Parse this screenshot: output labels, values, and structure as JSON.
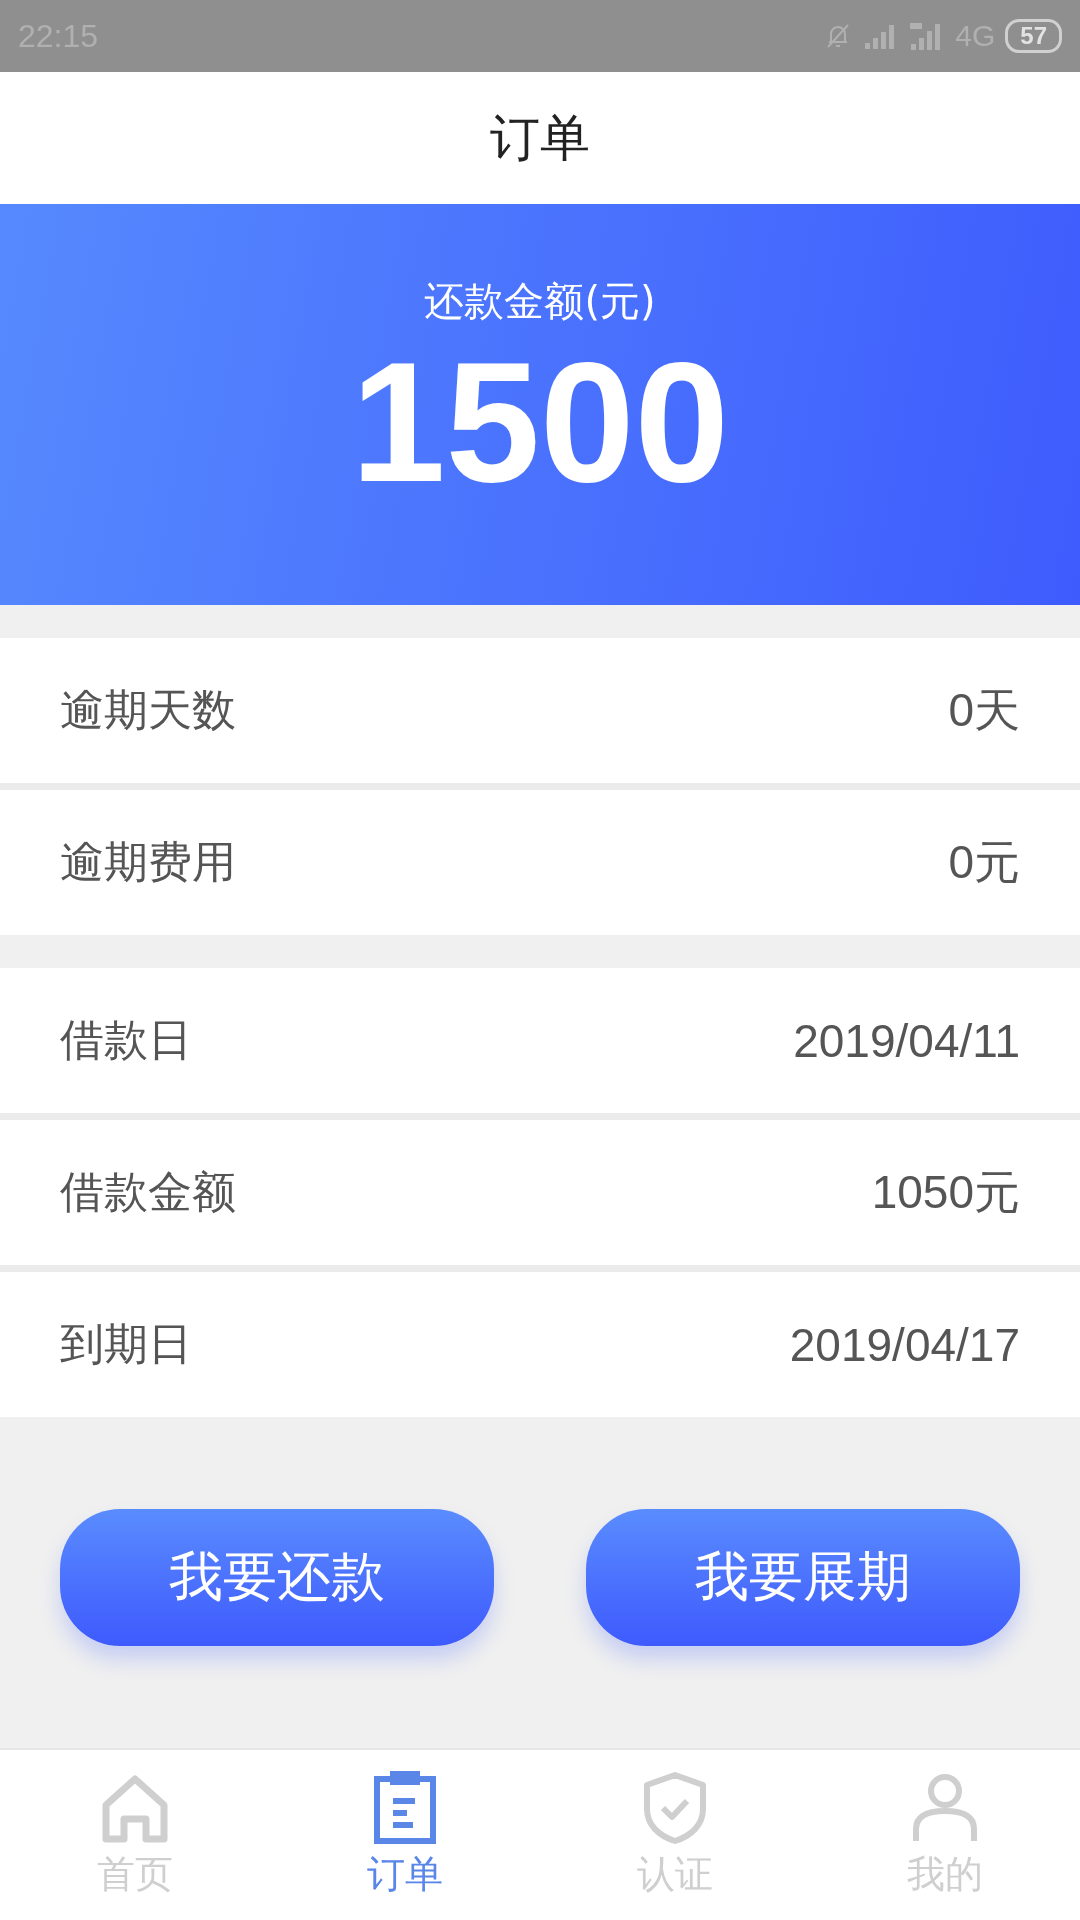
{
  "status_bar": {
    "time": "22:15",
    "network": "4G",
    "battery": "57"
  },
  "header": {
    "title": "订单"
  },
  "summary": {
    "label": "还款金额(元)",
    "amount": "1500"
  },
  "sections": [
    {
      "rows": [
        {
          "label": "逾期天数",
          "value": "0天"
        },
        {
          "label": "逾期费用",
          "value": "0元"
        }
      ]
    },
    {
      "rows": [
        {
          "label": "借款日",
          "value": "2019/04/11"
        },
        {
          "label": "借款金额",
          "value": "1050元"
        },
        {
          "label": "到期日",
          "value": "2019/04/17"
        }
      ]
    }
  ],
  "buttons": [
    "我要还款",
    "我要展期"
  ],
  "tabs": [
    {
      "label": "首页",
      "kind": "home",
      "selected": false
    },
    {
      "label": "订单",
      "kind": "order",
      "selected": true
    },
    {
      "label": "认证",
      "kind": "verify",
      "selected": false
    },
    {
      "label": "我的",
      "kind": "profile",
      "selected": false
    }
  ]
}
